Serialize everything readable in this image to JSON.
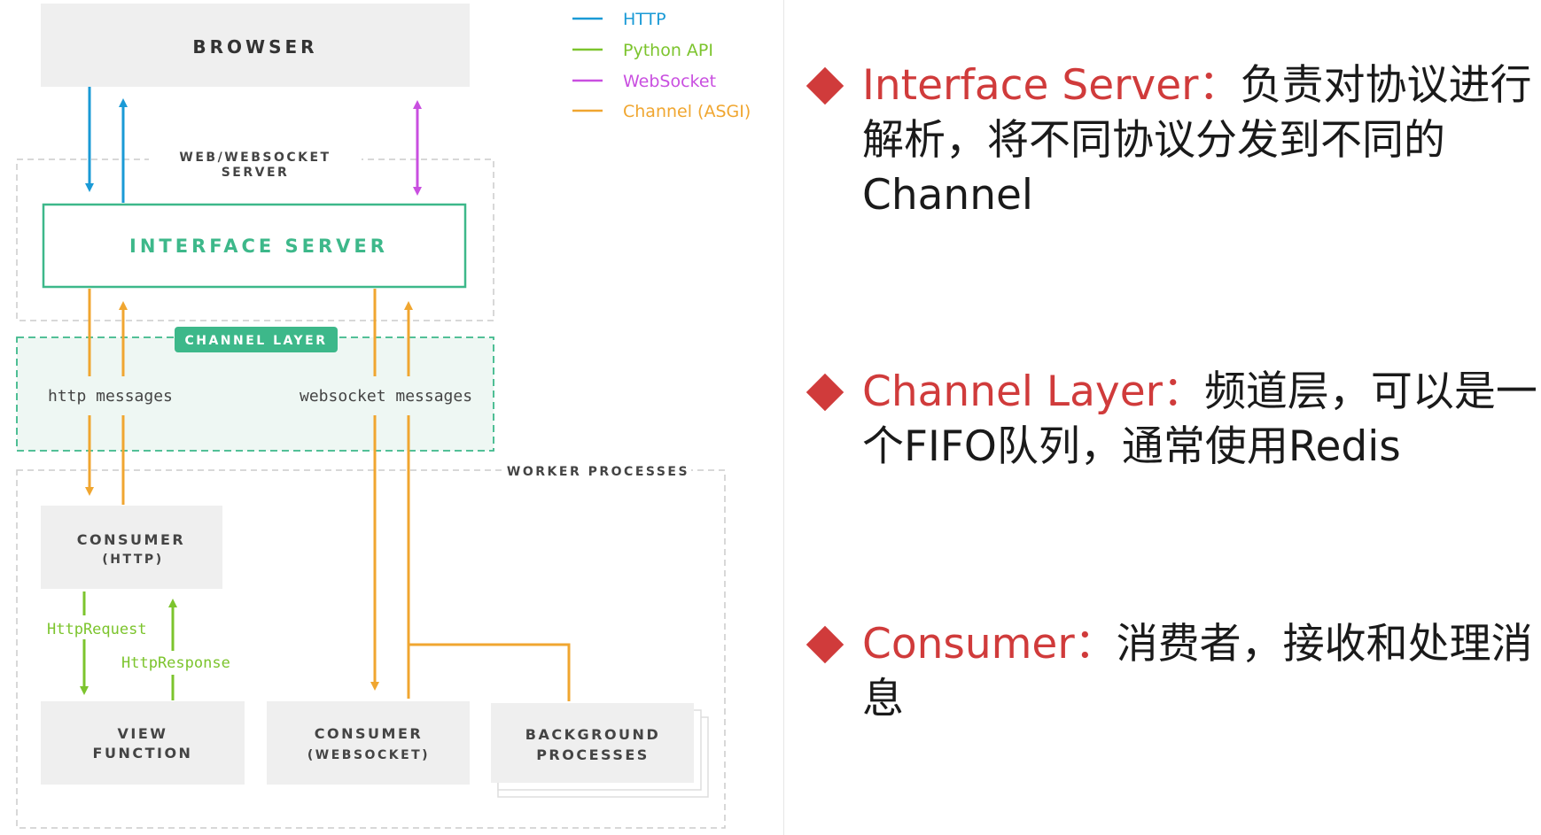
{
  "legend": [
    {
      "label": "HTTP",
      "color": "#1a9ad6"
    },
    {
      "label": "Python API",
      "color": "#7cc42d"
    },
    {
      "label": "WebSocket",
      "color": "#c94fe0"
    },
    {
      "label": "Channel (ASGI)",
      "color": "#f0a630"
    }
  ],
  "diagram": {
    "browser": "BROWSER",
    "web_server_group_line1": "WEB/WEBSOCKET",
    "web_server_group_line2": "SERVER",
    "interface_server": "INTERFACE SERVER",
    "channel_layer": "CHANNEL LAYER",
    "http_messages": "http messages",
    "websocket_messages": "websocket messages",
    "worker_processes": "WORKER PROCESSES",
    "consumer_http_line1": "CONSUMER",
    "consumer_http_line2": "(HTTP)",
    "http_request": "HttpRequest",
    "http_response": "HttpResponse",
    "view_function_line1": "VIEW",
    "view_function_line2": "FUNCTION",
    "consumer_ws_line1": "CONSUMER",
    "consumer_ws_line2": "(WEBSOCKET)",
    "background_line1": "BACKGROUND",
    "background_line2": "PROCESSES"
  },
  "colors": {
    "accent_red": "#d03b3b",
    "interface_green": "#3db88a",
    "channel_layer_fill": "#eef7f3",
    "box_gray": "#efefef"
  },
  "bullets": [
    {
      "term": "Interface Server",
      "colon": "：",
      "desc": "负责对协议进行解析，将不同协议分发到不同的Channel"
    },
    {
      "term": "Channel Layer",
      "colon": "：",
      "desc": "频道层，可以是一个FIFO队列，通常使用Redis"
    },
    {
      "term": "Consumer",
      "colon": "：",
      "desc": "消费者，接收和处理消息"
    }
  ]
}
